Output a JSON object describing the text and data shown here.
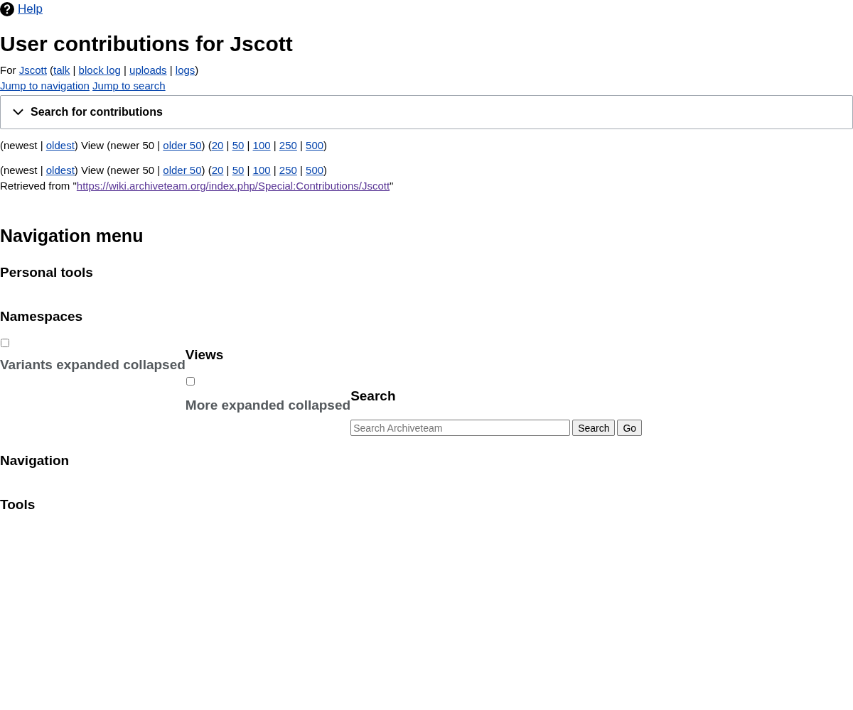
{
  "help_link": "Help",
  "title": "User contributions for Jscott",
  "user_line": [
    {
      "text": "For "
    },
    {
      "text": "Jscott",
      "link": true
    },
    {
      "text": " ("
    },
    {
      "text": "talk",
      "link": true
    },
    {
      "text": " | "
    },
    {
      "text": "block log",
      "link": true
    },
    {
      "text": " | "
    },
    {
      "text": "uploads",
      "link": true
    },
    {
      "text": " | "
    },
    {
      "text": "logs",
      "link": true
    },
    {
      "text": ")"
    }
  ],
  "jump_links": [
    "Jump to navigation",
    "Jump to search"
  ],
  "search_panel": {
    "label": "Search for contributions",
    "expanded": false
  },
  "pagers": [
    [
      {
        "text": "(newest | "
      },
      {
        "text": "oldest",
        "link": true
      },
      {
        "text": ") View (newer 50 | "
      },
      {
        "text": "older 50",
        "link": true
      },
      {
        "text": ") ("
      },
      {
        "text": "20",
        "link": true
      },
      {
        "text": " | "
      },
      {
        "text": "50",
        "link": true
      },
      {
        "text": " | "
      },
      {
        "text": "100",
        "link": true
      },
      {
        "text": " | "
      },
      {
        "text": "250",
        "link": true
      },
      {
        "text": " | "
      },
      {
        "text": "500",
        "link": true
      },
      {
        "text": ")"
      }
    ],
    [
      {
        "text": "(newest | "
      },
      {
        "text": "oldest",
        "link": true
      },
      {
        "text": ") View (newer 50 | "
      },
      {
        "text": "older 50",
        "link": true
      },
      {
        "text": ") ("
      },
      {
        "text": "20",
        "link": true
      },
      {
        "text": " | "
      },
      {
        "text": "50",
        "link": true
      },
      {
        "text": " | "
      },
      {
        "text": "100",
        "link": true
      },
      {
        "text": " | "
      },
      {
        "text": "250",
        "link": true
      },
      {
        "text": " | "
      },
      {
        "text": "500",
        "link": true
      },
      {
        "text": ")"
      }
    ]
  ],
  "retrieved": [
    {
      "text": "Retrieved from \""
    },
    {
      "text": "https://wiki.archiveteam.org/index.php/Special:Contributions/Jscott",
      "link": true,
      "visited": true
    },
    {
      "text": "\""
    }
  ],
  "nav_heading": "Navigation menu",
  "personal_tools": "Personal tools",
  "namespaces": "Namespaces",
  "variants": {
    "checked": false,
    "label": "Variants expanded collapsed"
  },
  "views": {
    "heading": "Views",
    "checked": false,
    "label": "More expanded collapsed"
  },
  "search": {
    "heading": "Search",
    "placeholder": "Search Archiveteam",
    "buttons": [
      "Search",
      "Go"
    ]
  },
  "navigation": "Navigation",
  "tools": "Tools"
}
